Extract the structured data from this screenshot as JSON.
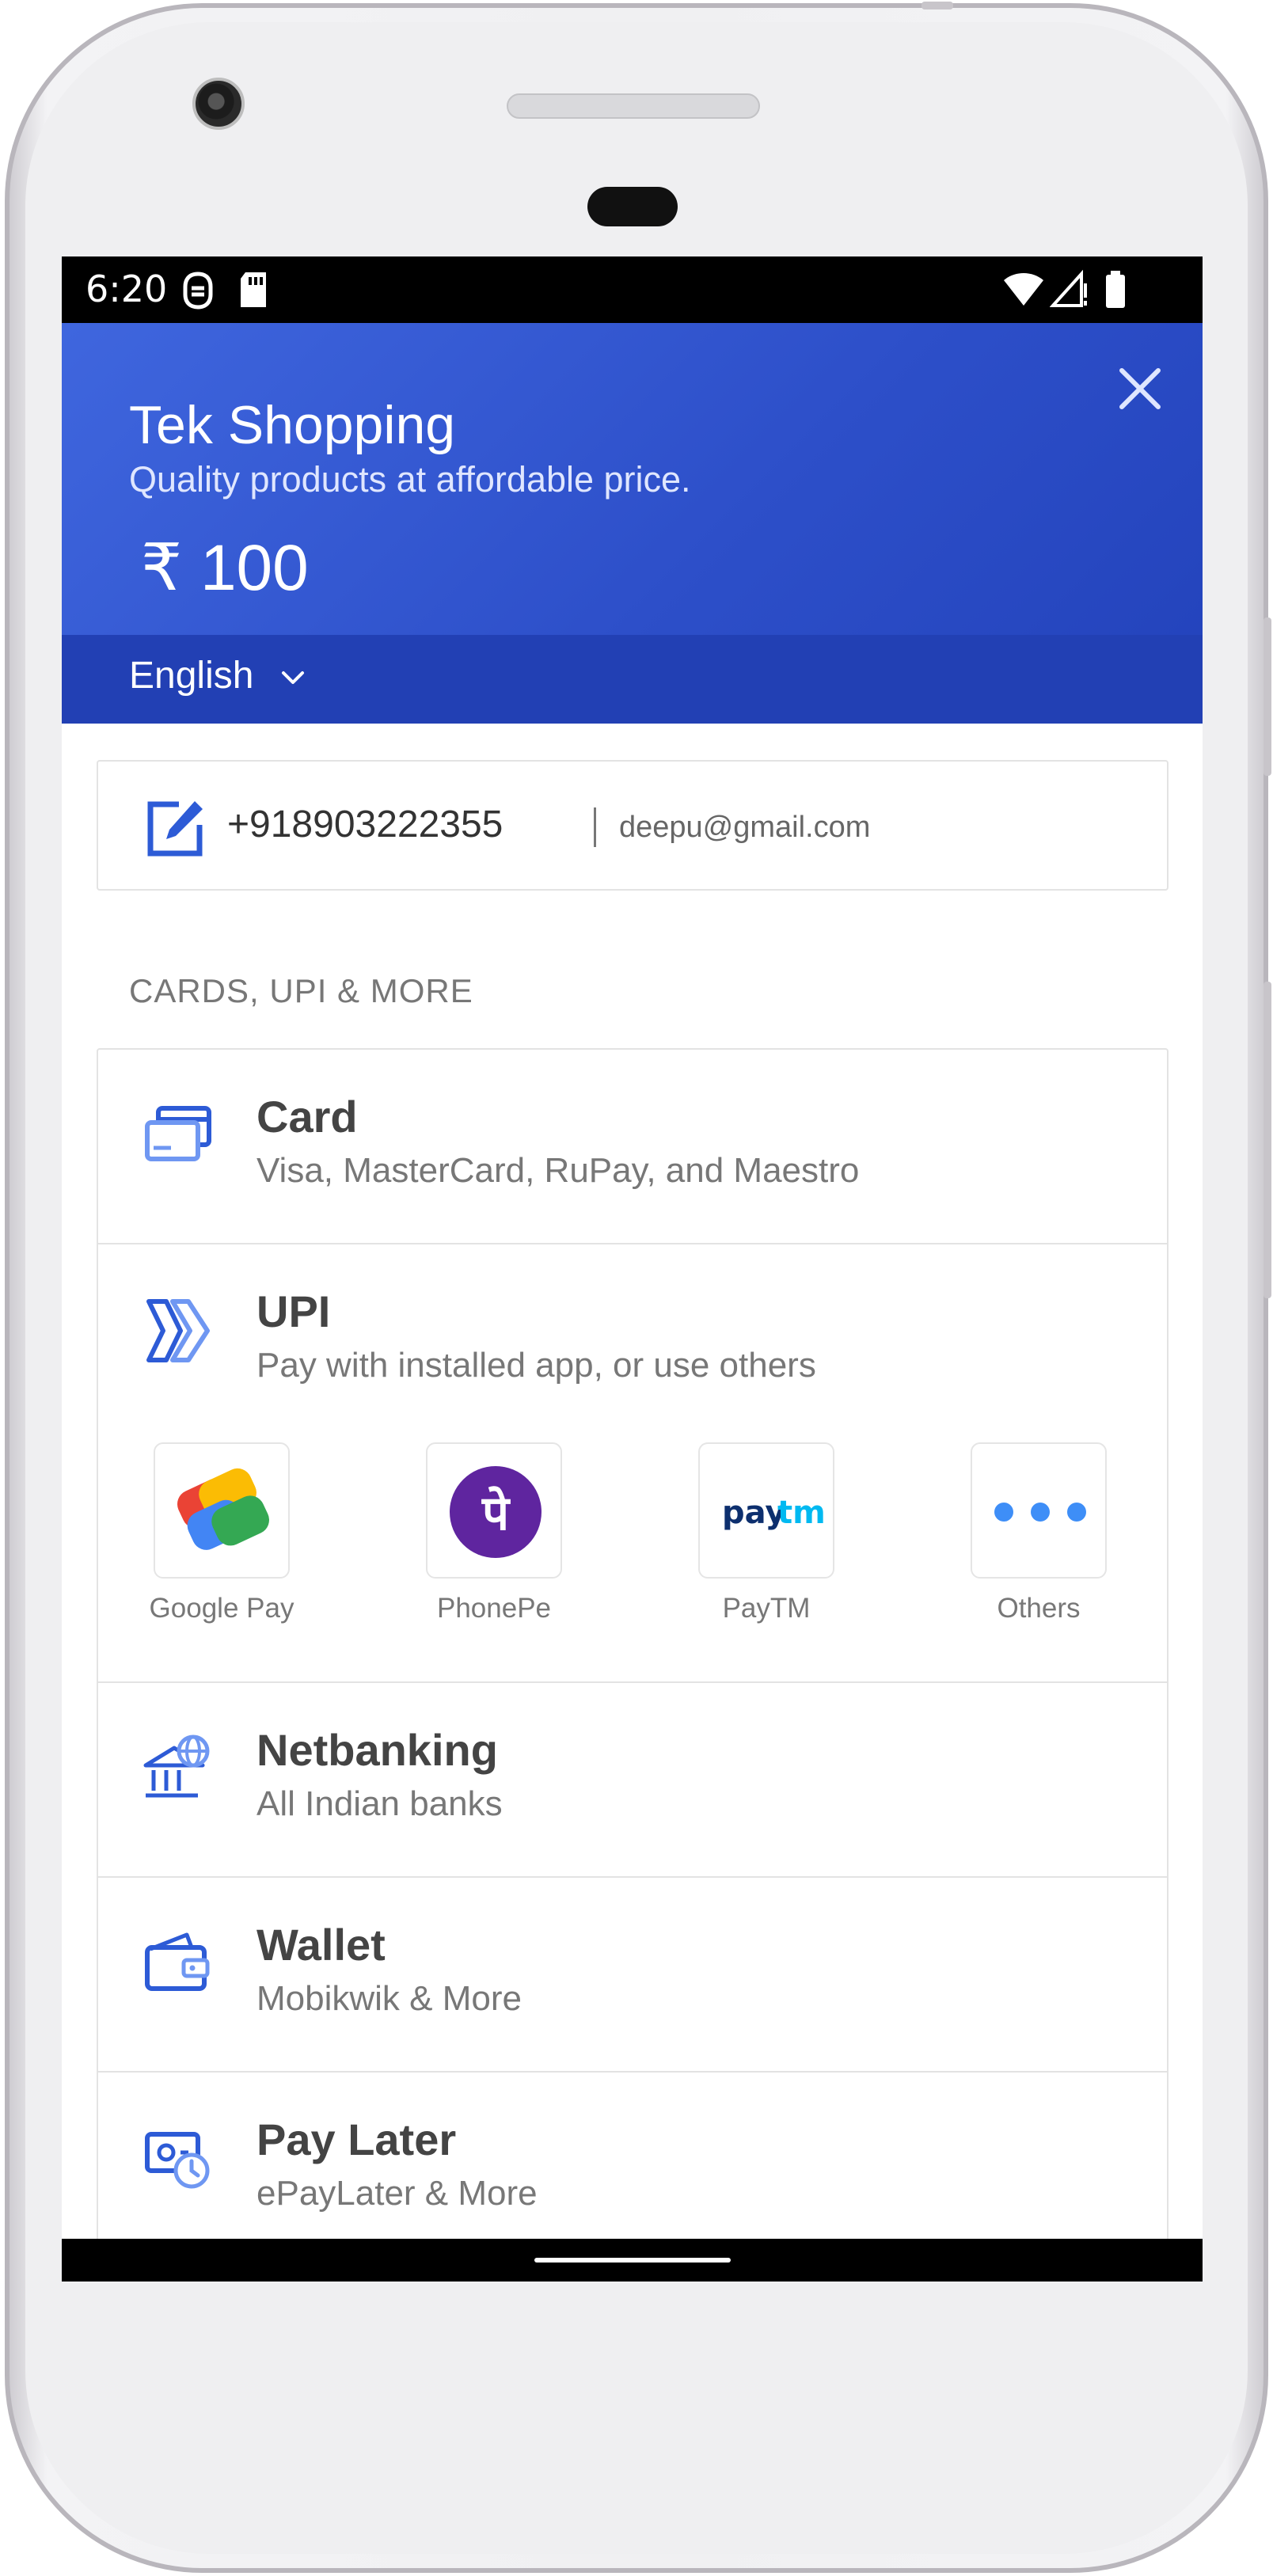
{
  "status_bar": {
    "time": "6:20"
  },
  "header": {
    "title": "Tek Shopping",
    "subtitle": "Quality products at affordable price.",
    "amount": "₹  100",
    "language": "English"
  },
  "contact": {
    "phone": "+918903222355",
    "email": "deepu@gmail.com"
  },
  "section_label": "CARDS, UPI & MORE",
  "methods": {
    "card": {
      "title": "Card",
      "subtitle": "Visa, MasterCard, RuPay, and Maestro"
    },
    "upi": {
      "title": "UPI",
      "subtitle": "Pay with installed app, or use others",
      "apps": [
        {
          "label": "Google Pay",
          "icon": "google-pay-icon"
        },
        {
          "label": "PhonePe",
          "icon": "phonepe-icon",
          "glyph": "पे"
        },
        {
          "label": "PayTM",
          "icon": "paytm-icon",
          "logo_text_1": "pay",
          "logo_text_2": "tm"
        },
        {
          "label": "Others",
          "icon": "more-dots-icon"
        }
      ]
    },
    "netbanking": {
      "title": "Netbanking",
      "subtitle": "All Indian banks"
    },
    "wallet": {
      "title": "Wallet",
      "subtitle": "Mobikwik & More"
    },
    "pay_later": {
      "title": "Pay Later",
      "subtitle": "ePayLater & More"
    }
  },
  "colors": {
    "header": "#3a5fd9",
    "language_bar": "#2240b4",
    "icon_blue": "#2d5bd6",
    "phonepe_purple": "#5f259f",
    "paytm_navy": "#0d2f6e",
    "paytm_cyan": "#00b9f1"
  }
}
